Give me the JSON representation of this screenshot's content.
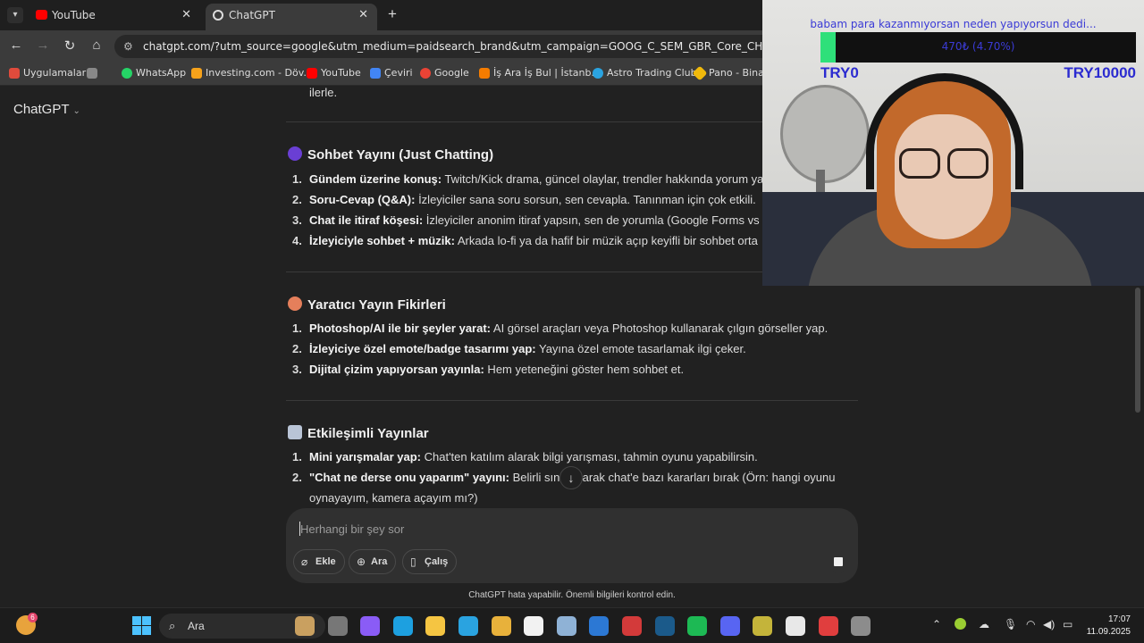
{
  "browser": {
    "tabs": [
      {
        "title": "YouTube",
        "icon": "youtube-icon"
      },
      {
        "title": "ChatGPT",
        "icon": "chatgpt-icon"
      }
    ],
    "new_tab_label": "+",
    "url": "chatgpt.com/?utm_source=google&utm_medium=paidsearch_brand&utm_campaign=GOOG_C_SEM_GBR_Core_CHT_BAU_ACQ_PER_M",
    "bookmarks": [
      {
        "label": "Uygulamalar",
        "color": "#e04b3c"
      },
      {
        "label": "",
        "color": "#888888"
      },
      {
        "label": "WhatsApp",
        "color": "#25d366"
      },
      {
        "label": "Investing.com - Döv...",
        "color": "#f6a21b"
      },
      {
        "label": "YouTube",
        "color": "#ff0000"
      },
      {
        "label": "Çeviri",
        "color": "#4285f4"
      },
      {
        "label": "Google",
        "color": "#ea4335"
      },
      {
        "label": "İş Ara İş Bul | İstanb...",
        "color": "#f57c00"
      },
      {
        "label": "Astro Trading Club",
        "color": "#2aa3e0"
      },
      {
        "label": "Pano - Binanc",
        "color": "#f0b90b"
      }
    ]
  },
  "chatgpt": {
    "title": "ChatGPT",
    "cut_text": "ilerle.",
    "sections": [
      {
        "heading": "Sohbet Yayını (Just Chatting)",
        "emoji_color": "#6a3fd4",
        "items": [
          {
            "num": "1.",
            "bold": "Gündem üzerine konuş:",
            "text": " Twitch/Kick drama, güncel olaylar, trendler hakkında yorum ya"
          },
          {
            "num": "2.",
            "bold": "Soru-Cevap (Q&A):",
            "text": " İzleyiciler sana soru sorsun, sen cevapla. Tanınman için çok etkili."
          },
          {
            "num": "3.",
            "bold": "Chat ile itiraf köşesi:",
            "text": " İzleyiciler anonim itiraf yapsın, sen de yorumla (Google Forms vs i"
          },
          {
            "num": "4.",
            "bold": "İzleyiciyle sohbet + müzik:",
            "text": " Arkada lo-fi ya da hafif bir müzik açıp keyifli bir sohbet orta"
          }
        ]
      },
      {
        "heading": "Yaratıcı Yayın Fikirleri",
        "emoji_color": "#e57f5b",
        "items": [
          {
            "num": "1.",
            "bold": "Photoshop/AI ile bir şeyler yarat:",
            "text": " AI görsel araçları veya Photoshop kullanarak çılgın görseller yap."
          },
          {
            "num": "2.",
            "bold": "İzleyiciye özel emote/badge tasarımı yap:",
            "text": " Yayına özel emote tasarlamak ilgi çeker."
          },
          {
            "num": "3.",
            "bold": "Dijital çizim yapıyorsan yayınla:",
            "text": " Hem yeteneğini göster hem sohbet et."
          }
        ]
      },
      {
        "heading": "Etkileşimli Yayınlar",
        "emoji_color": "#b9c4d6",
        "items": [
          {
            "num": "1.",
            "bold": "Mini yarışmalar yap:",
            "text": " Chat'ten katılım alarak bilgi yarışması, tahmin oyunu yapabilirsin."
          },
          {
            "num": "2.",
            "bold": "\"Chat ne derse onu yaparım\" yayını:",
            "text": " Belirli sınır     oyarak chat'e bazı kararları bırak (Örn: hangi oyunu",
            "cont": "oynayayım, kamera açayım mı?)"
          }
        ]
      }
    ],
    "scroll_down_icon": "↓",
    "composer": {
      "placeholder": "Herhangi bir şey sor",
      "tools": [
        {
          "label": "Ekle",
          "icon": "paperclip-icon",
          "glyph": "⌀"
        },
        {
          "label": "Ara",
          "icon": "globe-icon",
          "glyph": "⊕"
        },
        {
          "label": "Çalış",
          "icon": "book-icon",
          "glyph": "▯"
        }
      ]
    },
    "disclaimer": "ChatGPT hata yapabilir. Önemli bilgileri kontrol edin."
  },
  "overlay": {
    "caption": "babam para kazanmıyorsan neden yapıyorsun dedi...",
    "goal_text": "470₺ (4.70%)",
    "goal_fraction": 0.047,
    "min_label": "TRY0",
    "max_label": "TRY10000"
  },
  "taskbar": {
    "weather_badge": "6",
    "search_label": "Ara",
    "time": "17:07",
    "date": "11.09.2025",
    "apps": [
      {
        "name": "widgets-app",
        "color": "#c9a060"
      },
      {
        "name": "file-explorer-app",
        "color": "#777777"
      },
      {
        "name": "copilot-app",
        "color": "#8a5cf6"
      },
      {
        "name": "edge-app",
        "color": "#1da0e0"
      },
      {
        "name": "folder-app",
        "color": "#f5c542"
      },
      {
        "name": "telegram-app",
        "color": "#2aa3e0"
      },
      {
        "name": "chrome-app",
        "color": "#e8b13b"
      },
      {
        "name": "store-app",
        "color": "#f2f2f2"
      },
      {
        "name": "notepad-app",
        "color": "#8fb2d6"
      },
      {
        "name": "webull-app",
        "color": "#2c78d4"
      },
      {
        "name": "cpuz-app",
        "color": "#d33a3a"
      },
      {
        "name": "steam-app",
        "color": "#1b5a8a"
      },
      {
        "name": "spotify-app",
        "color": "#1db954"
      },
      {
        "name": "discord-app",
        "color": "#5865f2"
      },
      {
        "name": "obs-like-app",
        "color": "#c4b43a"
      },
      {
        "name": "capcut-app",
        "color": "#e8e8e8"
      },
      {
        "name": "opera-app",
        "color": "#e03e3e"
      },
      {
        "name": "settings-app",
        "color": "#8c8c8c"
      }
    ]
  }
}
